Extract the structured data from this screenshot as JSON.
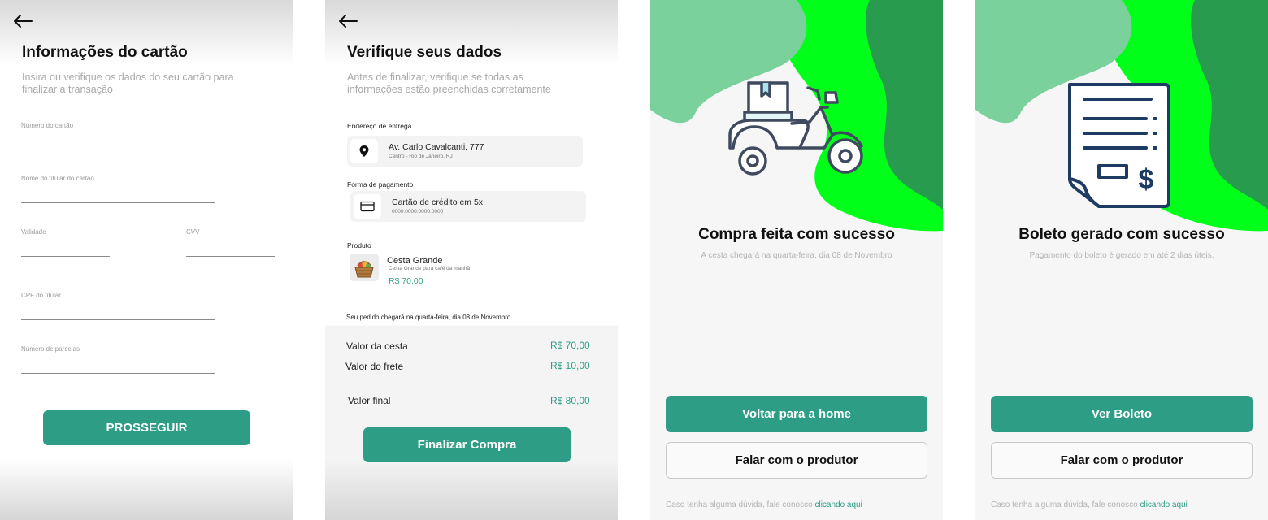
{
  "card_info": {
    "title": "Informações do cartão",
    "subtitle": "Insira ou verifique os dados do seu cartão para finalizar a transação",
    "fields": {
      "card_number": "Número do cartão",
      "holder_name": "Nome do titular do cartão",
      "expiry": "Validade",
      "cvv": "CVV",
      "holder_cpf": "CPF do titular",
      "installments": "Número de parcelas"
    },
    "proceed_label": "PROSSEGUIR"
  },
  "verify": {
    "title": "Verifique seus dados",
    "subtitle": "Antes de finalizar, verifique se todas as informações estão preenchidas corretamente",
    "address_label": "Endereço de entrega",
    "address_main": "Av. Carlo Cavalcanti, 777",
    "address_sub": "Centro - Rio de Janeiro, RJ",
    "payment_label": "Forma de pagamento",
    "payment_main": "Cartão de crédito em 5x",
    "payment_sub": "0000.0000.0000.0000",
    "product_label": "Produto",
    "product_name": "Cesta Grande",
    "product_desc": "Cesta Grande para café da manhã",
    "product_price": "R$ 70,00",
    "delivery_note": "Seu pedido chegará na quarta-feira, dia 08 de Novembro",
    "summary": [
      {
        "label": "Valor da cesta",
        "value": "R$ 70,00"
      },
      {
        "label": "Valor do frete",
        "value": "R$ 10,00"
      },
      {
        "label": "Valor final",
        "value": "R$ 80,00"
      }
    ],
    "finish_label": "Finalizar Compra"
  },
  "success": {
    "headline": "Compra feita com sucesso",
    "note": "A cesta chegará na quarta-feira, dia 08 de Novembro",
    "home_label": "Voltar para a home",
    "contact_label": "Falar com o produtor",
    "help_text": "Caso tenha alguma dúvida, fale conosco",
    "help_link": "clicando aqui"
  },
  "boleto": {
    "headline": "Boleto gerado com sucesso",
    "note": "Pagamento do boleto é gerado em até 2 dias úteis.",
    "view_label": "Ver Boleto",
    "contact_label": "Falar com o produtor",
    "help_text": "Caso tenha alguma dúvida, fale conosco",
    "help_link": "clicando aqui"
  },
  "icons": {
    "back": "arrow-left-icon",
    "location": "location-pin-icon",
    "credit_card": "credit-card-icon",
    "scooter": "delivery-scooter-icon",
    "invoice": "invoice-dollar-icon"
  },
  "colors": {
    "accent": "#2d9d86",
    "green_bright": "#00ff19",
    "green_light": "#7ad19b",
    "green_dark": "#289b4e",
    "icon_navy": "#1d3b63"
  }
}
